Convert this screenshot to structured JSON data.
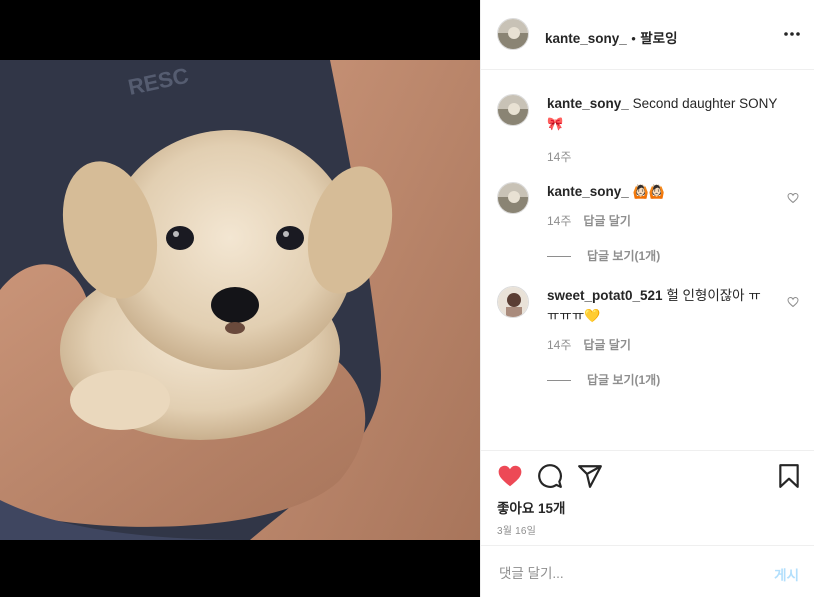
{
  "header": {
    "username": "kante_sony_",
    "separator": "•",
    "follow_label": "팔로잉",
    "more_icon": "more-horizontal-icon"
  },
  "caption": {
    "username": "kante_sony_",
    "text": "Second daughter SONY",
    "emoji": "🎀",
    "time": "14주"
  },
  "comments": [
    {
      "username": "kante_sony_",
      "text": "",
      "emoji": "🙆🏻🙆🏻",
      "time": "14주",
      "reply_label": "답글 달기",
      "view_replies": "답글 보기(1개)"
    },
    {
      "username": "sweet_potat0_521",
      "text": "헐 인형이잖아 ㅠㅠㅠㅠ",
      "emoji": "💛",
      "time": "14주",
      "reply_label": "답글 달기",
      "view_replies": "답글 보기(1개)"
    }
  ],
  "actions": {
    "like_icon": "heart-filled-icon",
    "comment_icon": "comment-icon",
    "share_icon": "send-icon",
    "save_icon": "bookmark-icon",
    "like_color": "#ed4956"
  },
  "likes": "좋아요 15개",
  "date": "3월 16일",
  "add_comment": {
    "placeholder": "댓글 달기...",
    "post_label": "게시",
    "post_color": "#b2dffc"
  }
}
